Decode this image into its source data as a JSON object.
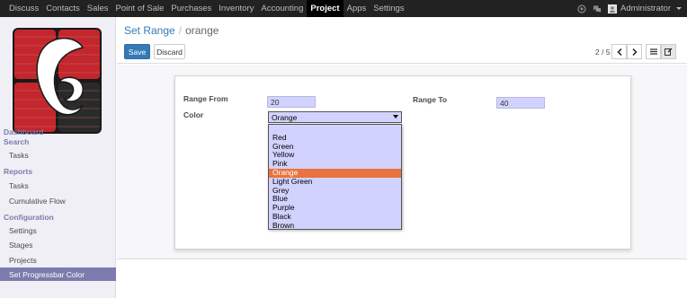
{
  "topbar": {
    "menu": [
      "Discuss",
      "Contacts",
      "Sales",
      "Point of Sale",
      "Purchases",
      "Inventory",
      "Accounting",
      "Project",
      "Apps",
      "Settings"
    ],
    "active": "Project",
    "user": "Administrator",
    "icons": [
      "globe-icon",
      "chat-icon"
    ]
  },
  "sidebar": {
    "sections": {
      "dashboard": "Dashboard",
      "search": "Search",
      "reports": "Reports",
      "configuration": "Configuration"
    },
    "items": {
      "tasks": "Tasks",
      "reports_tasks": "Tasks",
      "cumulative_flow": "Cumulative Flow",
      "settings": "Settings",
      "stages": "Stages",
      "projects": "Projects",
      "progressbar_color": "Set Progressbar Color"
    },
    "logo_colors": [
      "#c1272d",
      "#1a1a1a"
    ]
  },
  "control": {
    "breadcrumb_parent": "Set Range",
    "breadcrumb_separator": "/",
    "breadcrumb_current": "orange",
    "save_label": "Save",
    "discard_label": "Discard",
    "pager": "2 / 5",
    "icons": [
      "chevron-left-icon",
      "chevron-right-icon",
      "list-view-icon",
      "form-view-icon"
    ]
  },
  "form": {
    "range_from_label": "Range From",
    "range_from_value": "20",
    "range_to_label": "Range To",
    "range_to_value": "40",
    "color_label": "Color",
    "color_value": "Orange",
    "color_options": [
      "",
      "Red",
      "Green",
      "Yellow",
      "Pink",
      "Orange",
      "Light Green",
      "Grey",
      "Blue",
      "Purple",
      "Black",
      "Brown"
    ],
    "selected_option": "Orange"
  },
  "colors": {
    "accent": "#7c7bad",
    "primary": "#337ab7",
    "field_bg": "#d2d2ff",
    "highlight": "#e9733e"
  }
}
